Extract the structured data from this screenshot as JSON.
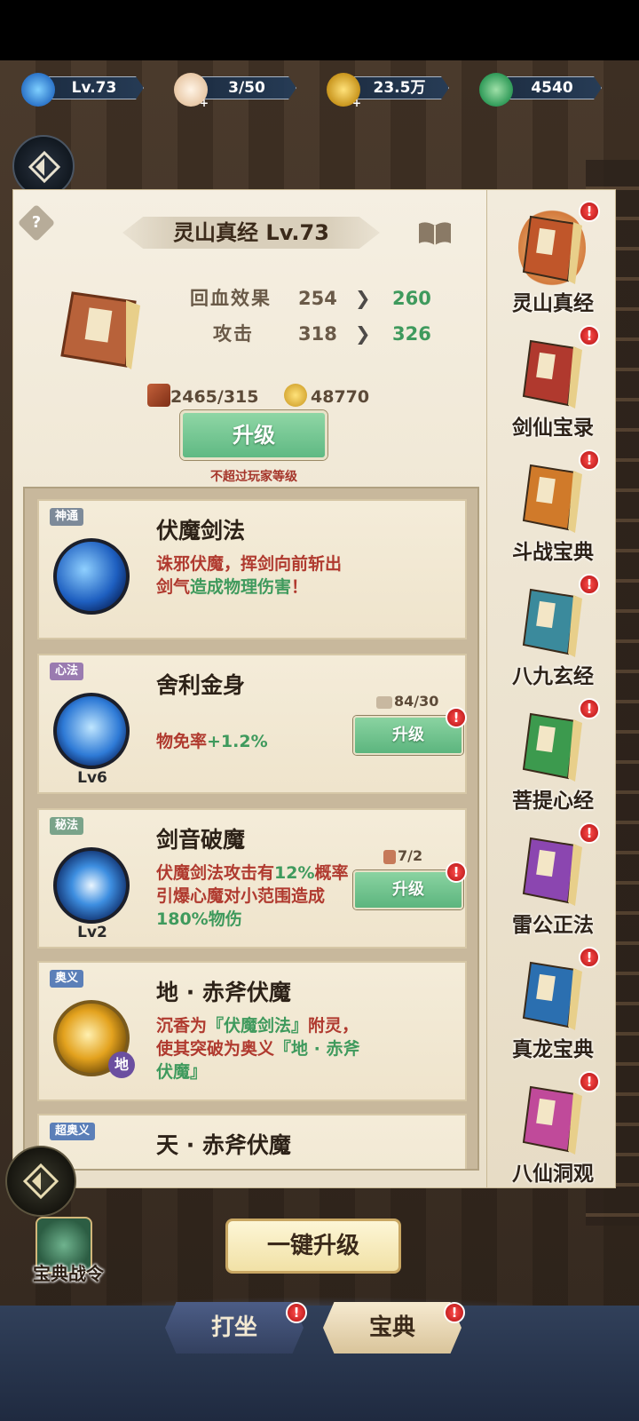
{
  "resources": {
    "level": "Lv.73",
    "stamina": "3/50",
    "coins": "23.5万",
    "jade": "4540"
  },
  "panel": {
    "title": "灵山真经 Lv.73",
    "stats": [
      {
        "label": "回血效果",
        "current": "254",
        "next": "260"
      },
      {
        "label": "攻击",
        "current": "318",
        "next": "326"
      }
    ],
    "cost_books": "2465/315",
    "cost_coins": "48770",
    "upgrade_label": "升级",
    "upgrade_note": "不超过玩家等级"
  },
  "skills": [
    {
      "tag": "神通",
      "name": "伏魔剑法",
      "desc_a": "诛邪伏魔，挥剑向前斩出剑气",
      "desc_g": "造成物理伤害",
      "desc_b": "！"
    },
    {
      "tag": "心法",
      "name": "舍利金身",
      "desc_a": "物免率",
      "desc_g": "+1.2%",
      "level": "Lv6",
      "cost": "84/30",
      "button": "升级",
      "alert": "!"
    },
    {
      "tag": "秘法",
      "name": "剑音破魔",
      "desc_a": "伏魔剑法攻击有",
      "desc_g": "12%",
      "desc_b": "概率引爆心魔对小范围造成",
      "desc_g2": "180%物伤",
      "level": "Lv2",
      "cost": "7/2",
      "button": "升级",
      "alert": "!"
    },
    {
      "tag": "奥义",
      "name": "地 · 赤斧伏魔",
      "desc_a": "沉香为",
      "desc_g": "『伏魔剑法』",
      "desc_b": "附灵，使其突破为奥义",
      "desc_g2": "『地 · 赤斧伏魔』",
      "badge": "地"
    },
    {
      "tag": "超奥义",
      "name": "天 · 赤斧伏魔"
    }
  ],
  "tabs": [
    {
      "label": "灵山真经",
      "color": "#c0562a",
      "active": true
    },
    {
      "label": "剑仙宝录",
      "color": "#b0392e"
    },
    {
      "label": "斗战宝典",
      "color": "#d07a2a"
    },
    {
      "label": "八九玄经",
      "color": "#3b8a9c"
    },
    {
      "label": "菩提心经",
      "color": "#3c9a4e"
    },
    {
      "label": "雷公正法",
      "color": "#8b46b0"
    },
    {
      "label": "真龙宝典",
      "color": "#2b6fb0"
    },
    {
      "label": "八仙洞观",
      "color": "#c04a9a"
    }
  ],
  "alert_mark": "!",
  "bottom": {
    "pass_label": "宝典战令",
    "onekey_label": "一键升级",
    "nav_sit": "打坐",
    "nav_book": "宝典"
  }
}
